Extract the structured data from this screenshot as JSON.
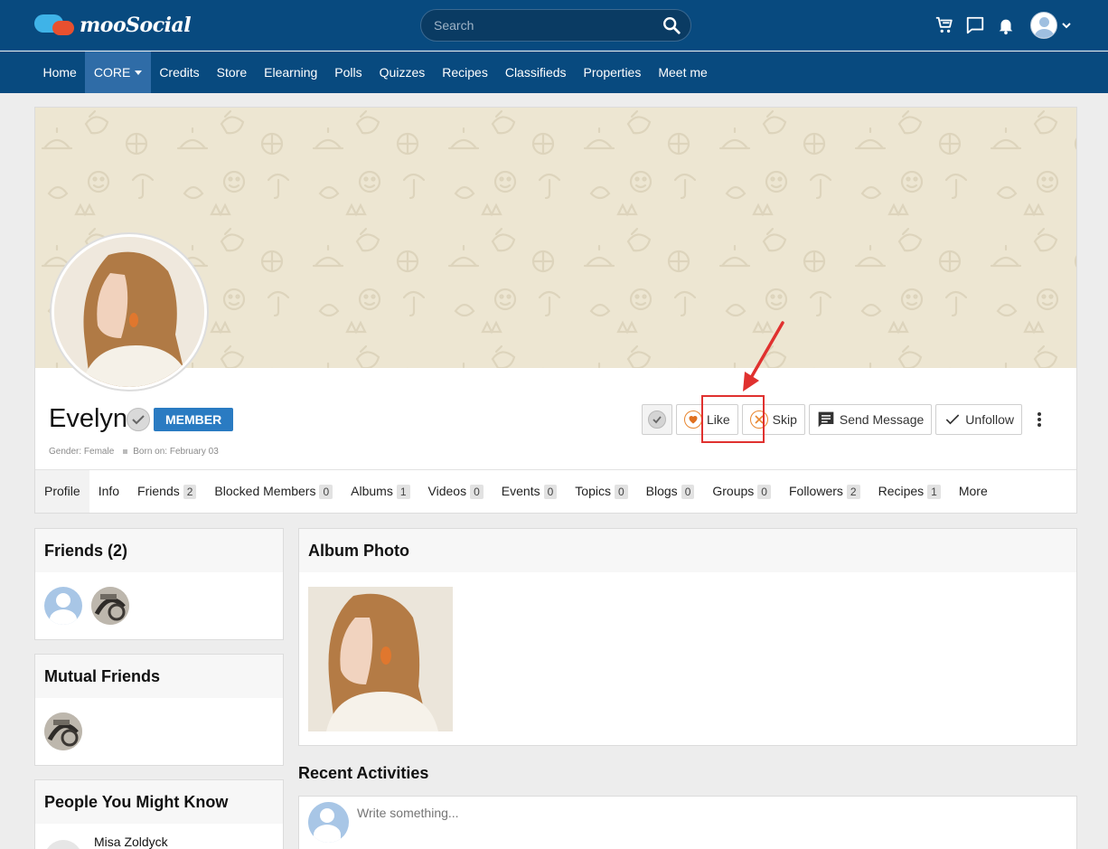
{
  "app": {
    "logo_text": "mooSocial"
  },
  "search": {
    "placeholder": "Search"
  },
  "nav": {
    "items": [
      {
        "label": "Home"
      },
      {
        "label": "CORE"
      },
      {
        "label": "Credits"
      },
      {
        "label": "Store"
      },
      {
        "label": "Elearning"
      },
      {
        "label": "Polls"
      },
      {
        "label": "Quizzes"
      },
      {
        "label": "Recipes"
      },
      {
        "label": "Classifieds"
      },
      {
        "label": "Properties"
      },
      {
        "label": "Meet me"
      }
    ]
  },
  "profile": {
    "name": "Evelyn",
    "badge": "MEMBER",
    "gender": "Gender: Female",
    "born": "Born on: February 03",
    "actions": {
      "like": "Like",
      "skip": "Skip",
      "message": "Send Message",
      "unfollow": "Unfollow"
    }
  },
  "tabs": [
    {
      "label": "Profile",
      "count": ""
    },
    {
      "label": "Info",
      "count": ""
    },
    {
      "label": "Friends",
      "count": "2"
    },
    {
      "label": "Blocked Members",
      "count": "0"
    },
    {
      "label": "Albums",
      "count": "1"
    },
    {
      "label": "Videos",
      "count": "0"
    },
    {
      "label": "Events",
      "count": "0"
    },
    {
      "label": "Topics",
      "count": "0"
    },
    {
      "label": "Blogs",
      "count": "0"
    },
    {
      "label": "Groups",
      "count": "0"
    },
    {
      "label": "Followers",
      "count": "2"
    },
    {
      "label": "Recipes",
      "count": "1"
    },
    {
      "label": "More",
      "count": ""
    }
  ],
  "sidebar": {
    "friends_title": "Friends (2)",
    "mutual_title": "Mutual Friends",
    "pymk_title": "People You Might Know",
    "pymk_first": "Misa Zoldyck"
  },
  "main": {
    "album_title": "Album Photo",
    "recent_title": "Recent Activities",
    "write_placeholder": "Write something..."
  },
  "colors": {
    "header": "#084a7f",
    "nav_active": "#2f6ca7",
    "badge": "#2a7bc2",
    "highlight": "#e0312f",
    "like": "#e8862f"
  }
}
